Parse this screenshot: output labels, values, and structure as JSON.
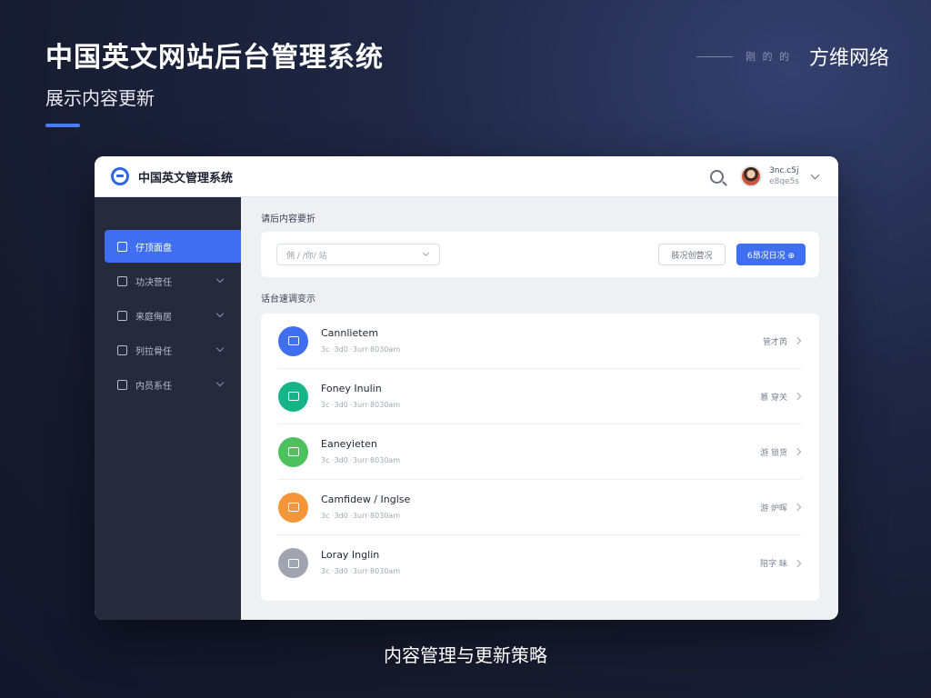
{
  "slide": {
    "title": "中国英文网站后台管理系统",
    "subtitle": "展示内容更新",
    "brand_mini": "刚 的 的",
    "brand": "方维网络",
    "caption": "内容管理与更新策略"
  },
  "app": {
    "title": "中国英文管理系统",
    "user": {
      "name": "3nc.c5j",
      "role": "e8qe5s"
    }
  },
  "sidebar": {
    "items": [
      {
        "label": "仔顶面盘",
        "active": true
      },
      {
        "label": "功决营任"
      },
      {
        "label": "来庭侮居"
      },
      {
        "label": "列拉骨任"
      },
      {
        "label": "内员系任"
      }
    ]
  },
  "main": {
    "section1": "请后内容要折",
    "filter": {
      "select_placeholder": "佣 / /你/ 站",
      "outline_button": "肢况创营况",
      "primary_button": "6昂况日况 ⊕"
    },
    "section2": "话台速调变示",
    "items": [
      {
        "title": "Cannlietem",
        "meta": "3c ·3d0 ·3urr·8030am",
        "status": "管才芮",
        "color": "#3f6ff0"
      },
      {
        "title": "Foney Inulin",
        "meta": "3c ·3d0 ·3urr·8030am",
        "status": "篡 穿关",
        "color": "#17b48a"
      },
      {
        "title": "Eaneyieten",
        "meta": "3c ·3d0 ·3urr·8030am",
        "status": "游 锁货",
        "color": "#4cc15e"
      },
      {
        "title": "Camfidew / Inglse",
        "meta": "3c ·3d0 ·3urr·8030am",
        "status": "游 炉晖",
        "color": "#f5953a"
      },
      {
        "title": "Loray Inglin",
        "meta": "3c ·3d0 ·3urr·8030am",
        "status": "陪字 昧",
        "color": "#9fa4b0"
      }
    ]
  }
}
